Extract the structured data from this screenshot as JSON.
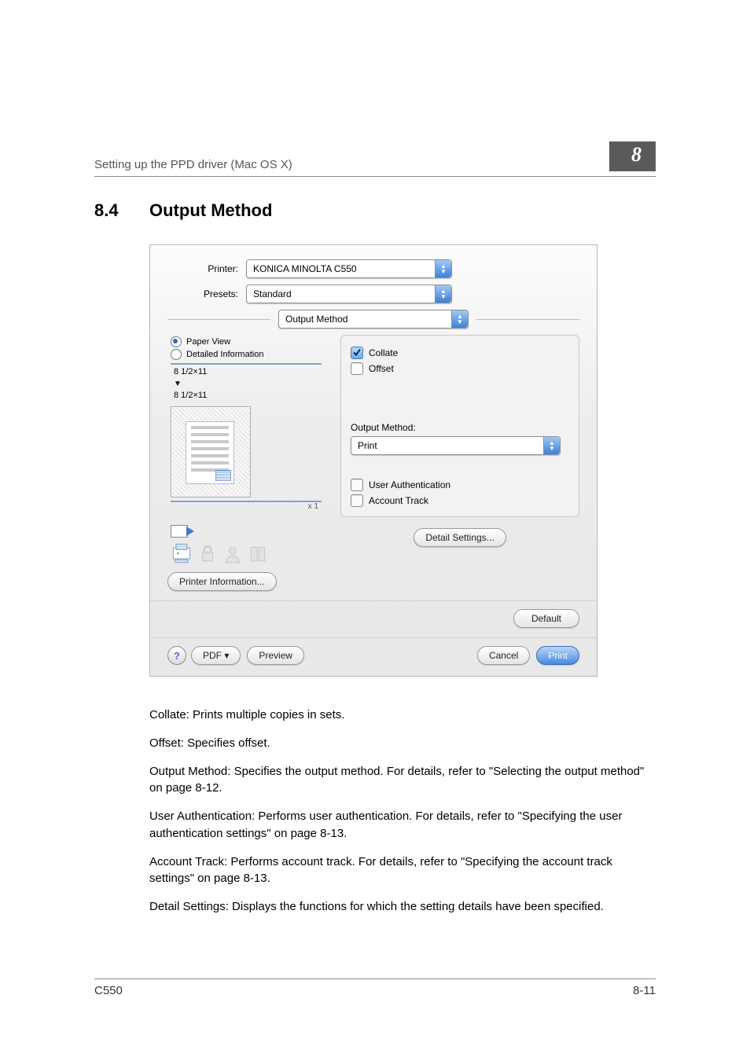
{
  "header": {
    "breadcrumb": "Setting up the PPD driver (Mac OS X)",
    "chapter": "8"
  },
  "section": {
    "number": "8.4",
    "title": "Output Method"
  },
  "dialog": {
    "printer_label": "Printer:",
    "printer_value": "KONICA MINOLTA C550",
    "presets_label": "Presets:",
    "presets_value": "Standard",
    "pane_value": "Output Method",
    "radios": {
      "paper_view": "Paper View",
      "detailed_info": "Detailed Information"
    },
    "size1": "8 1/2×11",
    "size2": "8 1/2×11",
    "xcount": "x 1",
    "printer_info_btn": "Printer Information...",
    "opts": {
      "collate": "Collate",
      "offset": "Offset",
      "output_method_label": "Output Method:",
      "output_method_value": "Print",
      "user_auth": "User Authentication",
      "account_track": "Account Track"
    },
    "detail_settings_btn": "Detail Settings...",
    "default_btn": "Default",
    "pdf_btn": "PDF ▾",
    "preview_btn": "Preview",
    "cancel_btn": "Cancel",
    "print_btn": "Print",
    "help": "?"
  },
  "body": {
    "p1": "Collate: Prints multiple copies in sets.",
    "p2": "Offset: Specifies offset.",
    "p3": "Output Method: Specifies the output method. For details, refer to \"Selecting the output method\" on page 8-12.",
    "p4": "User Authentication: Performs user authentication. For details, refer to \"Specifying the user authentication settings\" on page 8-13.",
    "p5": "Account Track: Performs account track. For details, refer to \"Specifying the account track settings\" on page 8-13.",
    "p6": "Detail Settings: Displays the functions for which the setting details have been specified."
  },
  "footer": {
    "model": "C550",
    "page": "8-11"
  }
}
